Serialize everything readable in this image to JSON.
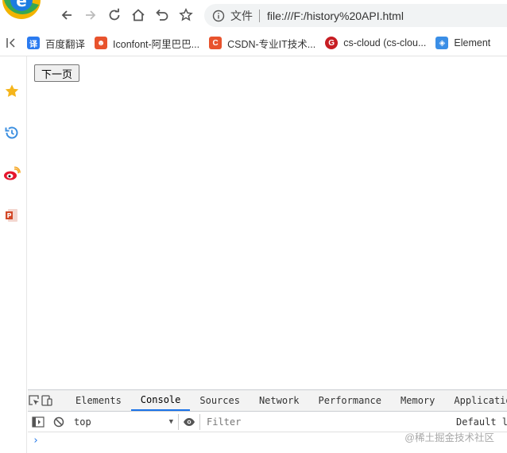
{
  "toolbar": {
    "address_label": "文件",
    "url": "file:///F:/history%20API.html"
  },
  "bookmarks": [
    {
      "label": "百度翻译",
      "icon": "baidu-translate-icon",
      "glyph": "译",
      "color": "#2b7bf0"
    },
    {
      "label": "Iconfont-阿里巴巴...",
      "icon": "iconfont-icon",
      "glyph": "☻",
      "color": "#e8532d"
    },
    {
      "label": "CSDN-专业IT技术...",
      "icon": "csdn-icon",
      "glyph": "C",
      "color": "#e8532d"
    },
    {
      "label": "cs-cloud (cs-clou...",
      "icon": "gitee-icon",
      "glyph": "G",
      "color": "#c71d23"
    },
    {
      "label": "Element",
      "icon": "element-icon",
      "glyph": "◈",
      "color": "#3a8ee6"
    }
  ],
  "page": {
    "next_button": "下一页"
  },
  "devtools": {
    "tabs": [
      "Elements",
      "Console",
      "Sources",
      "Network",
      "Performance",
      "Memory",
      "Application"
    ],
    "active_tab": "Console",
    "context": "top",
    "filter_placeholder": "Filter",
    "levels": "Default levels",
    "prompt": "›"
  },
  "watermark": "@稀土掘金技术社区"
}
